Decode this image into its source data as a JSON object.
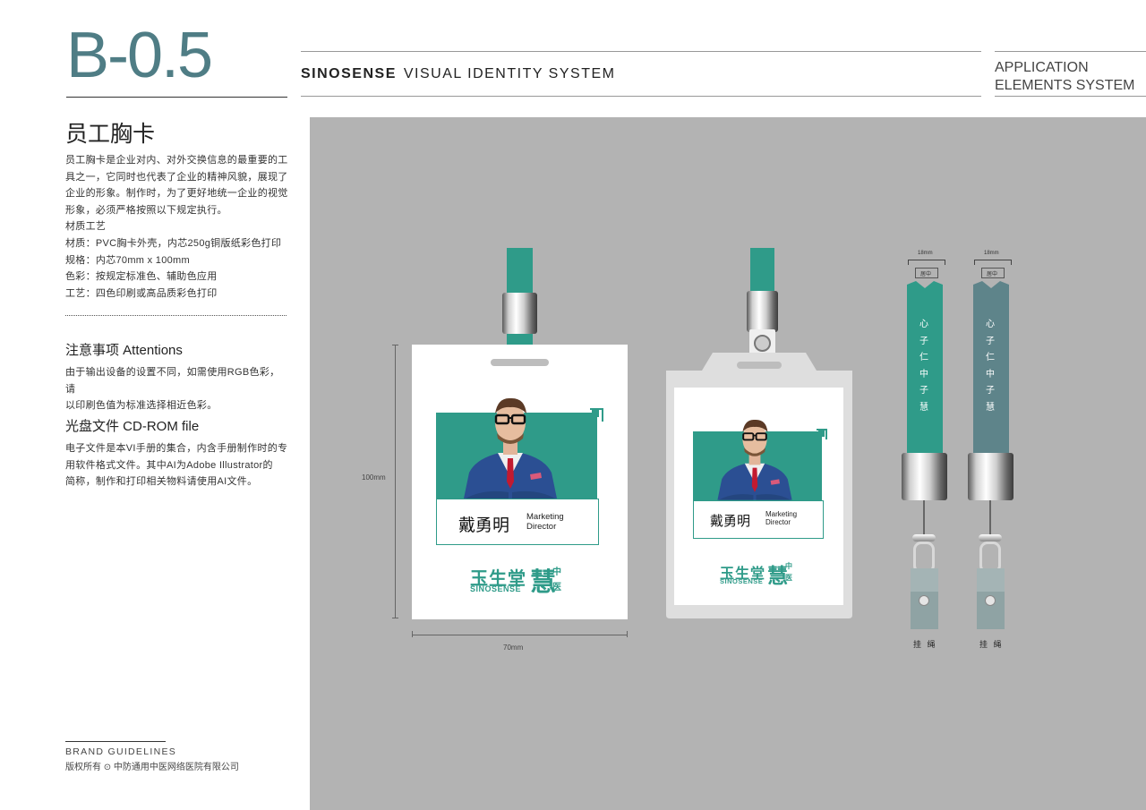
{
  "header": {
    "code": "B-0.5",
    "brand_bold": "SINOSENSE",
    "brand_rest": "VISUAL IDENTITY SYSTEM",
    "app_line1": "APPLICATION",
    "app_line2": "ELEMENTS SYSTEM"
  },
  "left": {
    "title": "员工胸卡",
    "intro": [
      "员工胸卡是企业对内、对外交换信息的最重要的工",
      "具之一，它同时也代表了企业的精神风貌，展现了",
      "企业的形象。制作时，为了更好地统一企业的视觉",
      "形象，必须严格按照以下规定执行。",
      "材质工艺",
      "材质：PVC胸卡外壳，内芯250g铜版纸彩色打印",
      "规格：内芯70mm x 100mm",
      "色彩：按规定标准色、辅助色应用",
      "工艺：四色印刷或高品质彩色打印"
    ],
    "attention_title": "注意事项 Attentions",
    "attention_text": [
      "由于输出设备的设置不同，如需使用RGB色彩，请",
      "以印刷色值为标准选择相近色彩。"
    ],
    "cd_title": "光盘文件 CD-ROM file",
    "cd_text": [
      "电子文件是本VI手册的集合，内含手册制作时的专",
      "用软件格式文件。其中AI为Adobe    Illustrator的",
      "简称，制作和打印相关物料请使用AI文件。"
    ],
    "footer_line1": "BRAND   GUIDELINES",
    "footer_line2": "版权所有 ⊙ 中防通用中医网络医院有限公司"
  },
  "badge": {
    "name": "戴勇明",
    "role_line1": "Marketing",
    "role_line2": "Director",
    "logo_cn": "玉生堂",
    "logo_en": "SINOSENSE",
    "logo_hui": "慧",
    "logo_zhong": "中",
    "logo_yi": "医",
    "dim_height": "100mm",
    "dim_width": "70mm"
  },
  "lanyards": {
    "text": [
      "慧",
      "子",
      "中",
      "仁",
      "子",
      "心"
    ],
    "width_label": "18mm",
    "center_label": "居中",
    "caption": "挂 绳"
  },
  "colors": {
    "teal": "#2f9b89",
    "slate": "#5e848a",
    "header_code": "#4f7d85",
    "canvas": "#b3b3b3"
  }
}
